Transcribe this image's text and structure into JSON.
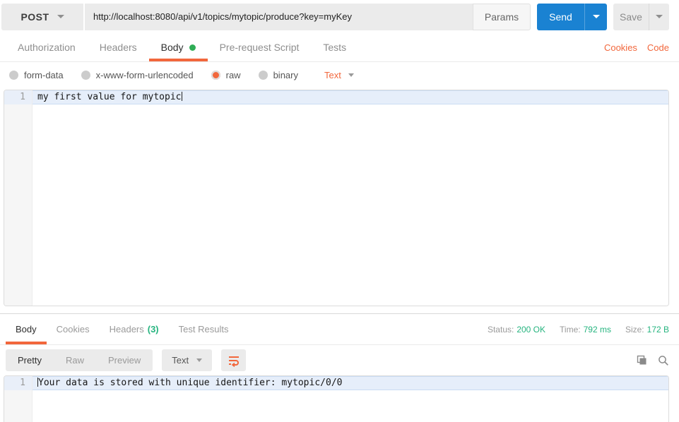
{
  "request": {
    "method": "POST",
    "url": "http://localhost:8080/api/v1/topics/mytopic/produce?key=myKey",
    "params_label": "Params",
    "send_label": "Send",
    "save_label": "Save",
    "tabs": [
      "Authorization",
      "Headers",
      "Body",
      "Pre-request Script",
      "Tests"
    ],
    "active_tab": "Body",
    "links": {
      "cookies": "Cookies",
      "code": "Code"
    },
    "body_modes": [
      "form-data",
      "x-www-form-urlencoded",
      "raw",
      "binary"
    ],
    "selected_mode": "raw",
    "raw_type": "Text",
    "editor": {
      "line_number": "1",
      "line_text": "my first value for mytopic"
    }
  },
  "response": {
    "tabs": [
      {
        "label": "Body"
      },
      {
        "label": "Cookies"
      },
      {
        "label": "Headers",
        "count": "(3)"
      },
      {
        "label": "Test Results"
      }
    ],
    "active_tab": "Body",
    "meta": {
      "status_label": "Status:",
      "status_value": "200 OK",
      "time_label": "Time:",
      "time_value": "792 ms",
      "size_label": "Size:",
      "size_value": "172 B"
    },
    "toolbar": {
      "views": [
        "Pretty",
        "Raw",
        "Preview"
      ],
      "active_view": "Pretty",
      "type": "Text"
    },
    "viewer": {
      "line_number": "1",
      "line_text": "Your data is stored with unique identifier: mytopic/0/0"
    }
  },
  "icons": {
    "method_caret": "chevron-down-icon",
    "wrap": "wrap-text-icon",
    "copy": "copy-icon",
    "search": "search-icon"
  },
  "colors": {
    "accent_orange": "#f2673c",
    "send_blue": "#1a82d2",
    "success_green": "#26b47f",
    "body_dot_green": "#2fad56",
    "active_line_bg": "#e6eefa",
    "control_gray": "#ebebeb"
  }
}
